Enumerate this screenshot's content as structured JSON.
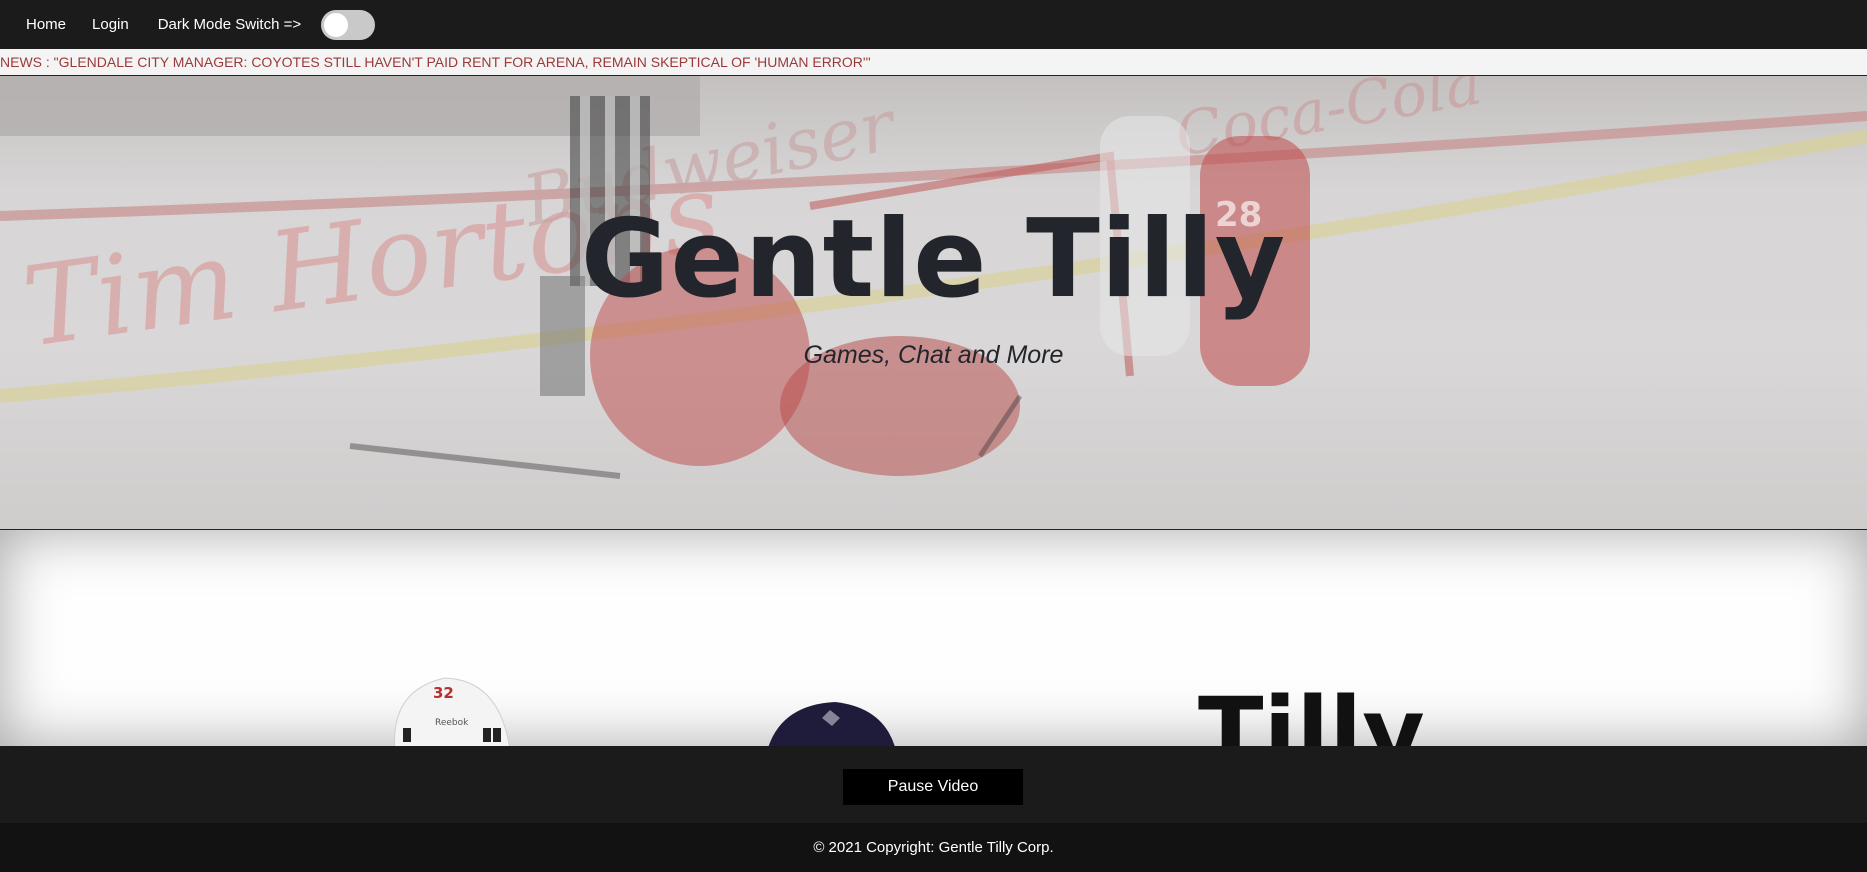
{
  "nav": {
    "home": "Home",
    "login": "Login",
    "dark_mode_label": "Dark Mode Switch =>",
    "dark_mode_on": false
  },
  "ticker": {
    "text": "NEWS : \"GLENDALE CITY MANAGER: COYOTES STILL HAVEN'T PAID RENT FOR ARENA, REMAIN SKEPTICAL OF 'HUMAN ERROR'\""
  },
  "hero": {
    "title": "Gentle Tilly",
    "subtitle": "Games, Chat and More",
    "bg_text_1": "Tim Hortons",
    "bg_text_2": "Budweiser",
    "bg_text_3": "Coca-Cola",
    "jersey_number": "28"
  },
  "content": {
    "title": "Tilly",
    "helmet_number": "32",
    "helmet_brand": "Reebok"
  },
  "controls": {
    "pause_label": "Pause Video"
  },
  "footer": {
    "copyright": "© 2021 Copyright: Gentle Tilly Corp."
  },
  "colors": {
    "nav_bg": "#1b1b1b",
    "ticker_text": "#9a3a3a",
    "title_text": "#22252b",
    "footer_bg": "#121212"
  }
}
